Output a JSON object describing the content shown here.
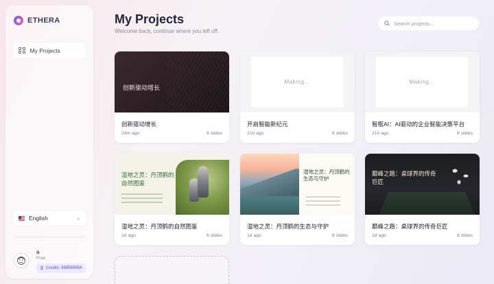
{
  "brand": {
    "name": "ETHERA"
  },
  "sidebar": {
    "nav": [
      {
        "label": "My Projects",
        "icon": "grid-icon"
      }
    ],
    "language": "English",
    "user": {
      "name": "a",
      "plan": "Free",
      "credits": "Credits: 999549954"
    }
  },
  "header": {
    "title": "My Projects",
    "subtitle": "Welcome back, continue where you left off.",
    "search_placeholder": "Search projects..."
  },
  "projects": [
    {
      "title": "创新驱动增长",
      "time": "24m ago",
      "slides": "8 slides",
      "status": "ready",
      "thumb_title": "创新驱动增长"
    },
    {
      "title": "开启智能新纪元",
      "time": "21h ago",
      "slides": "6 slides",
      "status": "making",
      "making_label": "Making..."
    },
    {
      "title": "智枢AI：AI驱动的企业智能决策平台",
      "time": "21h ago",
      "slides": "8 slides",
      "status": "making",
      "making_label": "Making..."
    },
    {
      "title": "湿地之灵：丹顶鹤的自然图鉴",
      "time": "1d ago",
      "slides": "6 slides",
      "status": "ready",
      "thumb_title": "湿地之灵：丹顶鹤的自然图鉴"
    },
    {
      "title": "湿地之灵：丹顶鹤的生态与守护",
      "time": "1d ago",
      "slides": "6 slides",
      "status": "ready",
      "thumb_title": "湿地之灵：丹顶鹤的生态与守护"
    },
    {
      "title": "巅峰之路：桌球界的传奇巨匠",
      "time": "1d ago",
      "slides": "6 slides",
      "status": "ready",
      "thumb_title": "巅峰之路：桌球界的传奇巨匠"
    }
  ],
  "colors": {
    "accent": "#5b4dc9",
    "brand_gradient_start": "#6a5be0",
    "brand_gradient_end": "#e56ab0"
  }
}
